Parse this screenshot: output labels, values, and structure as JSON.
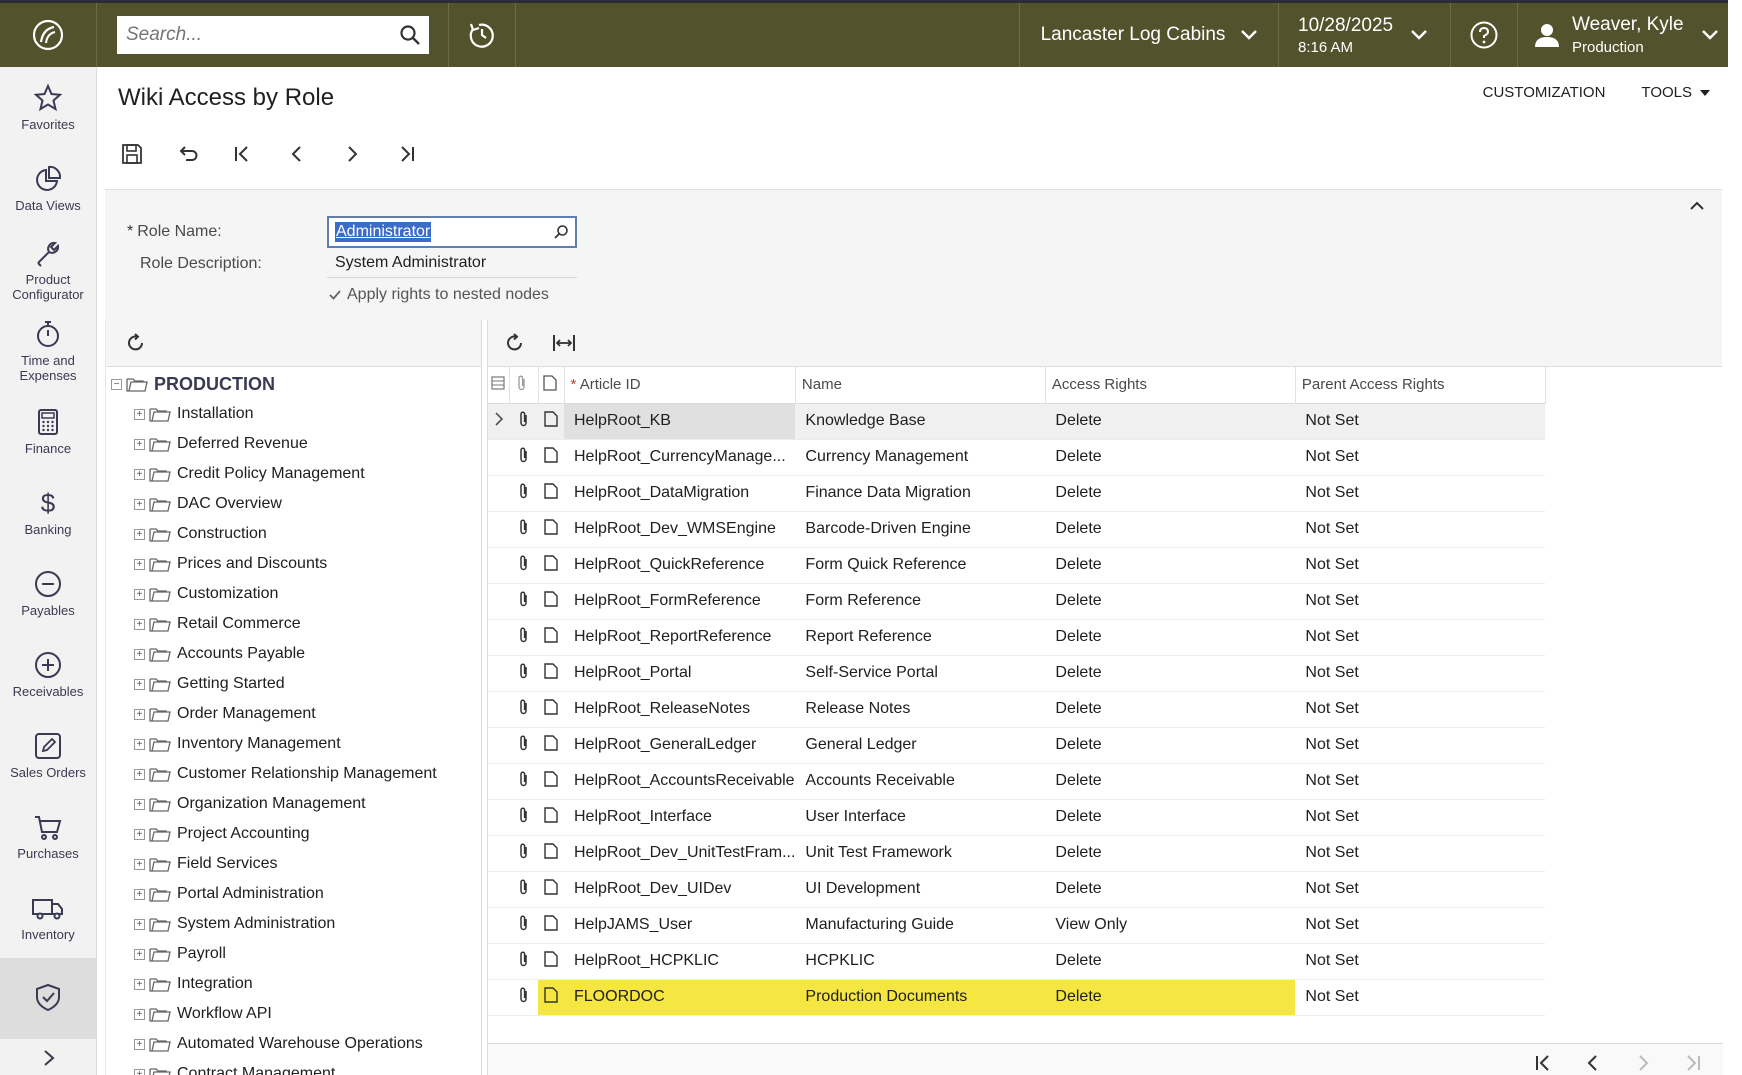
{
  "topbar": {
    "search_placeholder": "Search...",
    "company": "Lancaster Log Cabins",
    "date": "10/28/2025",
    "time": "8:16 AM",
    "user_name": "Weaver, Kyle",
    "tenant": "Production"
  },
  "leftnav": {
    "items": [
      {
        "label": "Favorites",
        "icon": "star-icon"
      },
      {
        "label": "Data Views",
        "icon": "pie-chart-icon"
      },
      {
        "label": "Product Configurator",
        "icon": "wrench-icon"
      },
      {
        "label": "Time and Expenses",
        "icon": "stopwatch-icon"
      },
      {
        "label": "Finance",
        "icon": "calculator-icon"
      },
      {
        "label": "Banking",
        "icon": "dollar-icon"
      },
      {
        "label": "Payables",
        "icon": "minus-circle-icon"
      },
      {
        "label": "Receivables",
        "icon": "plus-circle-icon"
      },
      {
        "label": "Sales Orders",
        "icon": "edit-icon"
      },
      {
        "label": "Purchases",
        "icon": "cart-icon"
      },
      {
        "label": "Inventory",
        "icon": "truck-icon"
      },
      {
        "label": "",
        "icon": "shield-check-icon"
      }
    ]
  },
  "page": {
    "title": "Wiki Access by Role",
    "customization": "CUSTOMIZATION",
    "tools": "TOOLS"
  },
  "form": {
    "role_name_label": "Role Name:",
    "role_name_value": "Administrator",
    "role_description_label": "Role Description:",
    "role_description_value": "System Administrator",
    "apply_nested_label": "Apply rights to nested nodes"
  },
  "tree": {
    "root": "PRODUCTION",
    "nodes": [
      "Installation",
      "Deferred Revenue",
      "Credit Policy Management",
      "DAC Overview",
      "Construction",
      "Prices and Discounts",
      "Customization",
      "Retail Commerce",
      "Accounts Payable",
      "Getting Started",
      "Order Management",
      "Inventory Management",
      "Customer Relationship Management",
      "Organization Management",
      "Project Accounting",
      "Field Services",
      "Portal Administration",
      "System Administration",
      "Payroll",
      "Integration",
      "Workflow API",
      "Automated Warehouse Operations",
      "Contract Management"
    ]
  },
  "grid": {
    "columns": {
      "article_id": "Article ID",
      "name": "Name",
      "access_rights": "Access Rights",
      "parent_access_rights": "Parent Access Rights"
    },
    "rows": [
      {
        "id": "HelpRoot_KB",
        "name": "Knowledge Base",
        "access": "Delete",
        "parent": "Not Set"
      },
      {
        "id": "HelpRoot_CurrencyManage...",
        "name": "Currency Management",
        "access": "Delete",
        "parent": "Not Set"
      },
      {
        "id": "HelpRoot_DataMigration",
        "name": "Finance Data Migration",
        "access": "Delete",
        "parent": "Not Set"
      },
      {
        "id": "HelpRoot_Dev_WMSEngine",
        "name": "Barcode-Driven Engine",
        "access": "Delete",
        "parent": "Not Set"
      },
      {
        "id": "HelpRoot_QuickReference",
        "name": "Form Quick Reference",
        "access": "Delete",
        "parent": "Not Set"
      },
      {
        "id": "HelpRoot_FormReference",
        "name": "Form Reference",
        "access": "Delete",
        "parent": "Not Set"
      },
      {
        "id": "HelpRoot_ReportReference",
        "name": "Report Reference",
        "access": "Delete",
        "parent": "Not Set"
      },
      {
        "id": "HelpRoot_Portal",
        "name": "Self-Service Portal",
        "access": "Delete",
        "parent": "Not Set"
      },
      {
        "id": "HelpRoot_ReleaseNotes",
        "name": "Release Notes",
        "access": "Delete",
        "parent": "Not Set"
      },
      {
        "id": "HelpRoot_GeneralLedger",
        "name": "General Ledger",
        "access": "Delete",
        "parent": "Not Set"
      },
      {
        "id": "HelpRoot_AccountsReceivable",
        "name": "Accounts Receivable",
        "access": "Delete",
        "parent": "Not Set"
      },
      {
        "id": "HelpRoot_Interface",
        "name": "User Interface",
        "access": "Delete",
        "parent": "Not Set"
      },
      {
        "id": "HelpRoot_Dev_UnitTestFram...",
        "name": "Unit Test Framework",
        "access": "Delete",
        "parent": "Not Set"
      },
      {
        "id": "HelpRoot_Dev_UIDev",
        "name": "UI Development",
        "access": "Delete",
        "parent": "Not Set"
      },
      {
        "id": "HelpJAMS_User",
        "name": "Manufacturing Guide",
        "access": "View Only",
        "parent": "Not Set"
      },
      {
        "id": "HelpRoot_HCPKLIC",
        "name": "HCPKLIC",
        "access": "Delete",
        "parent": "Not Set"
      },
      {
        "id": "FLOORDOC",
        "name": "Production Documents",
        "access": "Delete",
        "parent": "Not Set"
      }
    ]
  },
  "colors": {
    "topbar": "#52522c",
    "highlight": "#f5e642",
    "selection": "#3a6cc8"
  }
}
